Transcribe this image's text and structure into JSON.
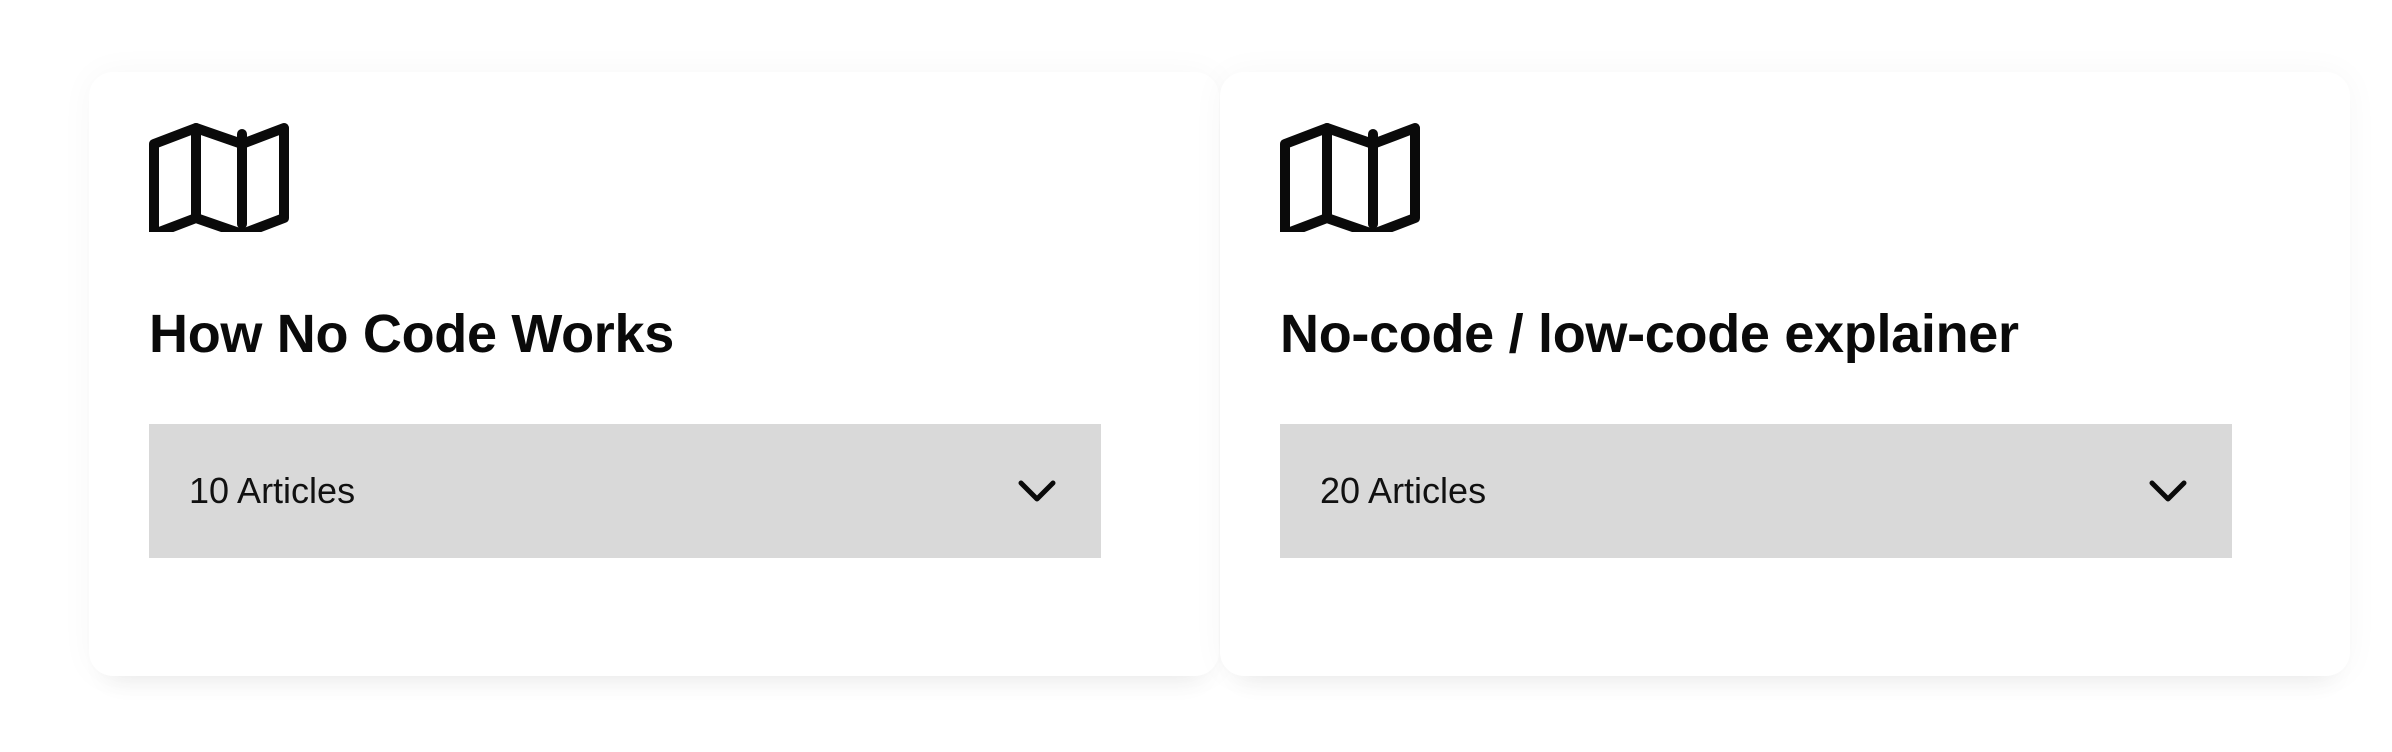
{
  "cards": [
    {
      "icon": "map-icon",
      "title": "How No Code Works",
      "articles_label": "10 Articles",
      "toggle_icon": "chevron-down-icon"
    },
    {
      "icon": "map-icon",
      "title": "No-code / low-code explainer",
      "articles_label": "20 Articles",
      "toggle_icon": "chevron-down-icon"
    }
  ],
  "colors": {
    "background": "#ffffff",
    "toggle_background": "#d9d9d9",
    "text": "#0a0a0a"
  }
}
